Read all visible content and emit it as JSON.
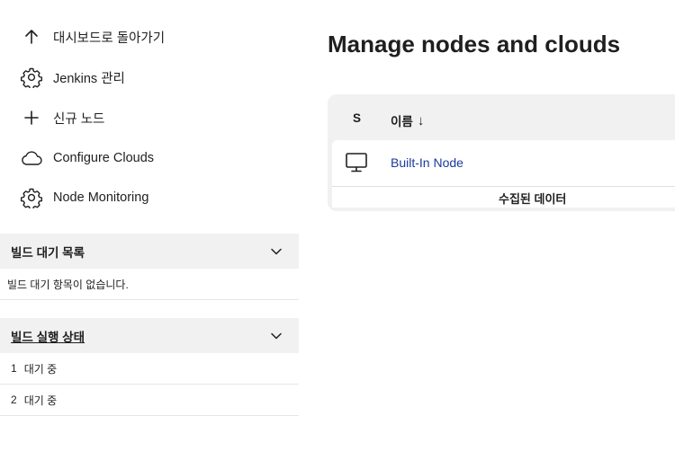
{
  "sidebar": {
    "items": [
      {
        "label": "대시보드로 돌아가기",
        "icon": "arrow-up-icon"
      },
      {
        "label": "Jenkins 관리",
        "icon": "gear-icon"
      },
      {
        "label": "신규 노드",
        "icon": "plus-icon"
      },
      {
        "label": "Configure Clouds",
        "icon": "cloud-icon"
      },
      {
        "label": "Node Monitoring",
        "icon": "gear-icon"
      }
    ],
    "build_queue": {
      "title": "빌드 대기 목록",
      "empty_message": "빌드 대기 항목이 없습니다."
    },
    "executor_status": {
      "title": "빌드 실행 상태",
      "rows": [
        {
          "number": "1",
          "status": "대기 중"
        },
        {
          "number": "2",
          "status": "대기 중"
        }
      ]
    }
  },
  "main": {
    "title": "Manage nodes and clouds",
    "table": {
      "col_status": "S",
      "col_name": "이름",
      "sort_indicator": "↓",
      "rows": [
        {
          "name": "Built-In Node",
          "icon": "computer-icon"
        }
      ],
      "footer": "수집된 데이터"
    }
  },
  "colors": {
    "link": "#1b3a9c",
    "panel_bg": "#f1f1f1",
    "text": "#1f1f1f"
  }
}
